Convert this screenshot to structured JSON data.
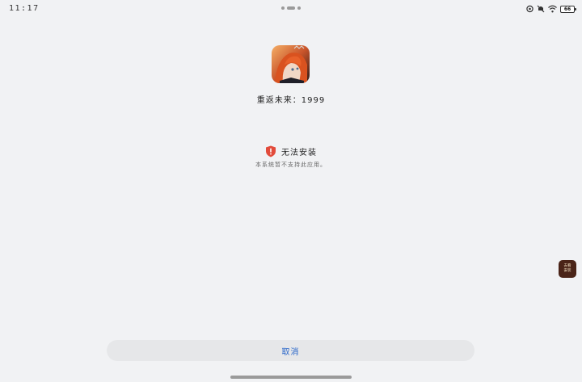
{
  "status_bar": {
    "time": "11:17",
    "battery_level": "66",
    "icons": [
      "location-icon",
      "mute-icon",
      "wifi-icon",
      "battery-icon"
    ]
  },
  "app": {
    "name": "重返未来：1999",
    "icon": "app-character-icon"
  },
  "install_error": {
    "title": "无法安装",
    "message": "本系统暂不支持此应用。",
    "icon": "shield-alert-icon",
    "accent_color": "#e24b3b"
  },
  "floating_app": {
    "label_line1": "去看",
    "label_line2": "安装"
  },
  "cancel_button": {
    "label": "取消",
    "color": "#2563c9"
  }
}
